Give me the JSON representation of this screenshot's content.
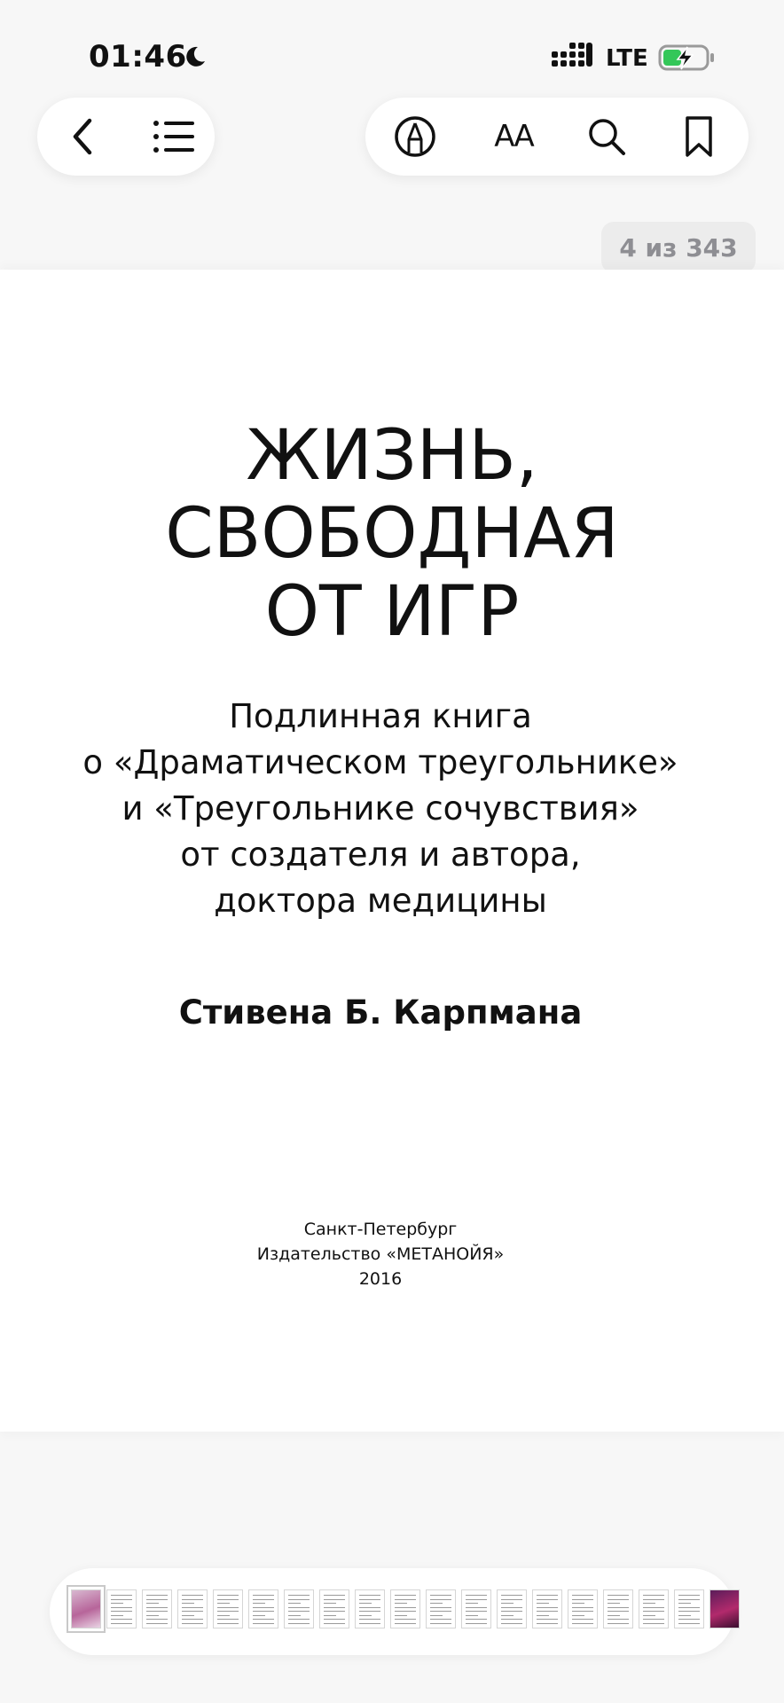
{
  "status_bar": {
    "time": "01:46",
    "network": "LTE",
    "moon_icon": "moon-icon",
    "signal_icon": "signal-bars-icon",
    "battery_icon": "battery-charging-icon",
    "battery_color": "#34c759"
  },
  "toolbar": {
    "left_icons": [
      "back-chevron-icon",
      "table-of-contents-icon"
    ],
    "right_icons": [
      "markup-pen-icon",
      "text-size-icon",
      "search-icon",
      "bookmark-icon"
    ],
    "text_size_glyph": "AA"
  },
  "page_counter": "4 из 343",
  "book": {
    "title_lines": [
      "ЖИЗНЬ,",
      "СВОБОДНАЯ",
      "ОТ ИГР"
    ],
    "subtitle_lines": [
      "Подлинная книга",
      "о «Драматическом треугольнике»",
      "и «Треугольнике сочувствия»",
      "от создателя и автора,",
      "доктора медицины"
    ],
    "author": "Стивена Б. Карпмана",
    "imprint_lines": [
      "Санкт-Петербург",
      "Издательство «МЕТАНОЙЯ»",
      "2016"
    ]
  },
  "thumbnail_bar": {
    "page_thumbnails": 19,
    "current_index": 0
  }
}
